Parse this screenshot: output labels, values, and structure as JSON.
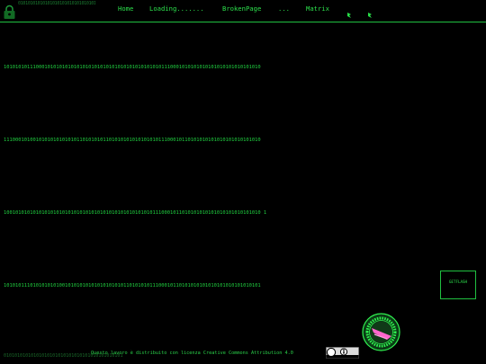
{
  "header": {
    "logo_strip": "01010101010101010101010101010101010",
    "nav": [
      "Home",
      "Loading.......",
      "BrokenPage",
      "...",
      "Matrix"
    ]
  },
  "icons": {
    "logo": "lock-icon",
    "nav_icons": [
      "bug-icon",
      "bug-icon"
    ]
  },
  "main": {
    "binary_lines": [
      "1010101011100010101010101010101010101010101010101010101110001010101010101010101010101010",
      "1110001010010101010101010110101010110101010101010101011100010110101010101010101010101010",
      "1001010101010101010101010101010101010101010101010101110001011010101010101010101010101010 1",
      "1010101110101010101001010101010101010101011010101011100010110101010101010101010101010101"
    ]
  },
  "getflash": {
    "label": "GETFLASH"
  },
  "footer": {
    "left_text": "01010101010101010101010101010101010101010101",
    "license": "Questo lavoro è distribuito con licenza Creative Commons Attribution 4.0"
  },
  "colors": {
    "background": "#000000",
    "accent": "#20e040",
    "badge_pink": "#ff66cc"
  }
}
